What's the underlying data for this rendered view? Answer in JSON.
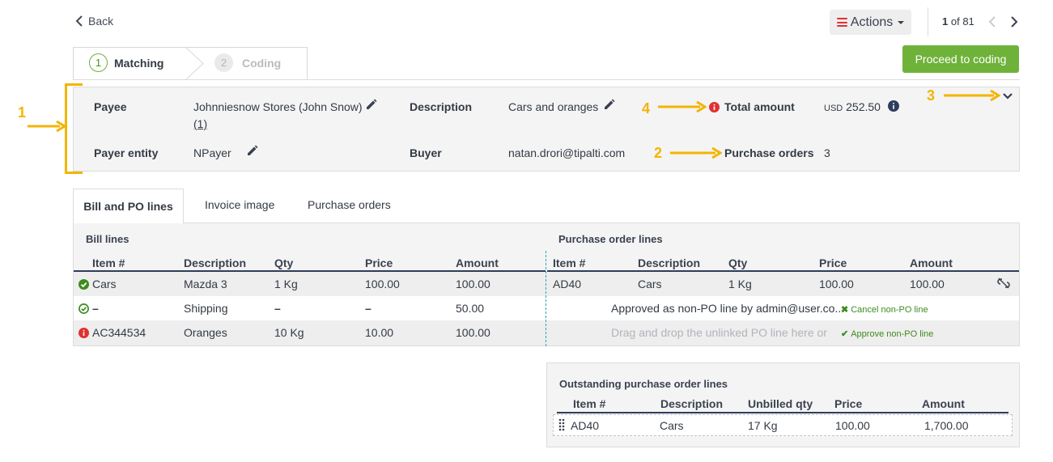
{
  "header": {
    "back_label": "Back",
    "actions_label": "Actions",
    "pager": {
      "current": "1",
      "separator": " of ",
      "total": "81"
    },
    "proceed_label": "Proceed to coding"
  },
  "stepper": {
    "steps": [
      {
        "number": "1",
        "label": "Matching"
      },
      {
        "number": "2",
        "label": "Coding"
      }
    ]
  },
  "summary": {
    "payee_label": "Payee",
    "payee_value": "Johnniesnow Stores (John Snow)",
    "payee_sub": "(1)",
    "payer_entity_label": "Payer entity",
    "payer_entity_value": "NPayer",
    "description_label": "Description",
    "description_value": "Cars and oranges",
    "buyer_label": "Buyer",
    "buyer_value": "natan.drori@tipalti.com",
    "total_amount_label": "Total amount",
    "total_currency": "USD",
    "total_value": "252.50",
    "purchase_orders_label": "Purchase orders",
    "purchase_orders_value": "3"
  },
  "annotations": [
    "1",
    "2",
    "3",
    "4"
  ],
  "tabs": [
    {
      "label": "Bill and PO lines"
    },
    {
      "label": "Invoice image"
    },
    {
      "label": "Purchase orders"
    }
  ],
  "bill_lines": {
    "title": "Bill lines",
    "columns": [
      "Item #",
      "Description",
      "Qty",
      "Price",
      "Amount"
    ],
    "rows": [
      {
        "status": "matched",
        "item": "Cars",
        "description": "Mazda 3",
        "qty": "1 Kg",
        "price": "100.00",
        "amount": "100.00"
      },
      {
        "status": "approved",
        "item": "–",
        "description": "Shipping",
        "qty": "–",
        "price": "–",
        "amount": "50.00"
      },
      {
        "status": "error",
        "item": "AC344534",
        "description": "Oranges",
        "qty": "10 Kg",
        "price": "10.00",
        "amount": "100.00"
      }
    ]
  },
  "po_lines": {
    "title": "Purchase order lines",
    "columns": [
      "Item #",
      "Description",
      "Qty",
      "Price",
      "Amount"
    ],
    "row": {
      "item": "AD40",
      "description": "Cars",
      "qty": "1 Kg",
      "price": "100.00",
      "amount": "100.00"
    },
    "approved_text": "Approved as non-PO line by admin@user.co...",
    "cancel_label": "Cancel non-PO line",
    "drop_placeholder": "Drag and drop the unlinked PO line here or",
    "approve_label": "Approve non-PO line"
  },
  "outstanding": {
    "title": "Outstanding purchase order lines",
    "columns": [
      "Item #",
      "Description",
      "Unbilled qty",
      "Price",
      "Amount"
    ],
    "rows": [
      {
        "item": "AD40",
        "description": "Cars",
        "unbilled_qty": "17 Kg",
        "price": "100.00",
        "amount": "1,700.00"
      }
    ]
  },
  "colors": {
    "accent_green": "#6fb23a",
    "annotation_yellow": "#f4b400",
    "error_red": "#e03131",
    "header_rule": "#2e3d5c"
  }
}
